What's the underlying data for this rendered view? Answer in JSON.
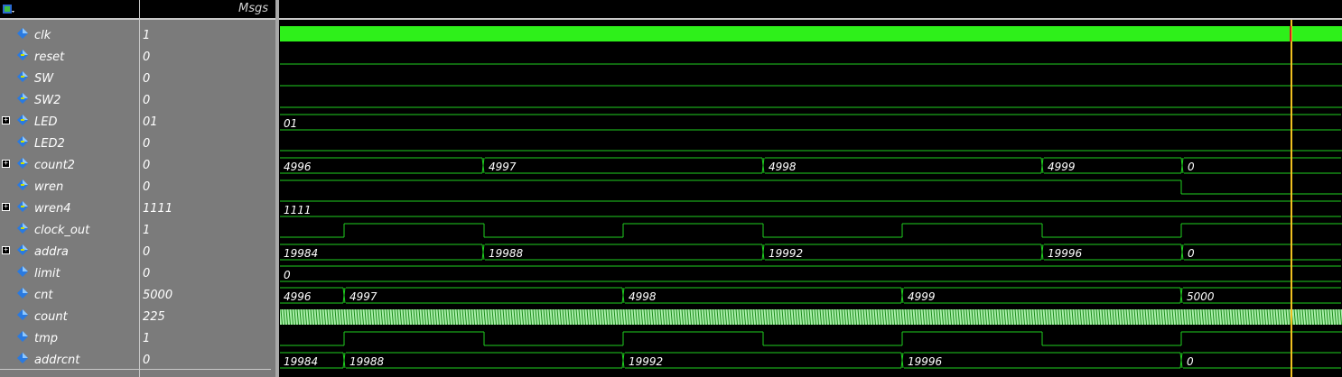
{
  "header": {
    "values_label": "Msgs"
  },
  "colors": {
    "wave": "#1fd01f",
    "clock": "#2ef01a",
    "cursor": "#f0c020",
    "count_fill": "#aaf0aa"
  },
  "signals": [
    {
      "name": "clk",
      "value": "1",
      "expandable": false
    },
    {
      "name": "reset",
      "value": "0",
      "expandable": false
    },
    {
      "name": "SW",
      "value": "0",
      "expandable": false
    },
    {
      "name": "SW2",
      "value": "0",
      "expandable": false
    },
    {
      "name": "LED",
      "value": "01",
      "expandable": true
    },
    {
      "name": "LED2",
      "value": "0",
      "expandable": false
    },
    {
      "name": "count2",
      "value": "0",
      "expandable": true
    },
    {
      "name": "wren",
      "value": "0",
      "expandable": false
    },
    {
      "name": "wren4",
      "value": "1111",
      "expandable": true
    },
    {
      "name": "clock_out",
      "value": "1",
      "expandable": false
    },
    {
      "name": "addra",
      "value": "0",
      "expandable": true
    },
    {
      "name": "limit",
      "value": "0",
      "expandable": false
    },
    {
      "name": "cnt",
      "value": "5000",
      "expandable": false
    },
    {
      "name": "count",
      "value": "225",
      "expandable": false
    },
    {
      "name": "tmp",
      "value": "1",
      "expandable": false
    },
    {
      "name": "addrcnt",
      "value": "0",
      "expandable": false
    }
  ],
  "wave_labels": {
    "LED": [
      "01"
    ],
    "count2": [
      "4996",
      "4997",
      "4998",
      "4999",
      "0"
    ],
    "wren4": [
      "1111"
    ],
    "addra": [
      "19984",
      "19988",
      "19992",
      "19996",
      "0"
    ],
    "limit": [
      "0"
    ],
    "cnt": [
      "4996",
      "4997",
      "4998",
      "4999",
      "5000"
    ],
    "addrcnt": [
      "19984",
      "19988",
      "19992",
      "19996",
      "0"
    ]
  }
}
